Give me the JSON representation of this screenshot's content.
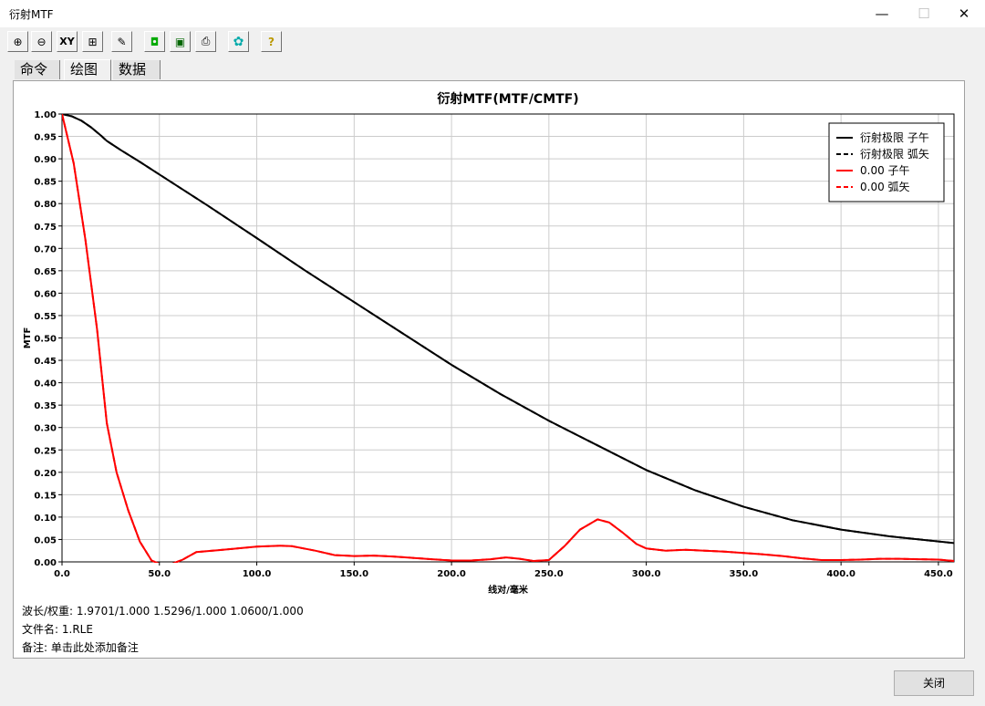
{
  "window": {
    "title": "衍射MTF",
    "minimize": "—",
    "maximize": "☐",
    "close": "✕"
  },
  "toolbar": {
    "buttons": [
      {
        "name": "zoom-in-icon",
        "glyph": "⊕"
      },
      {
        "name": "zoom-out-icon",
        "glyph": "⊖"
      },
      {
        "name": "xy-icon",
        "glyph": "XY"
      },
      {
        "name": "fit-icon",
        "glyph": "⊞"
      },
      {
        "name": "pen-icon",
        "glyph": "✎"
      },
      {
        "name": "camera-icon",
        "glyph": "◘"
      },
      {
        "name": "save-icon",
        "glyph": "▣"
      },
      {
        "name": "print-icon",
        "glyph": "⎙"
      },
      {
        "name": "settings-icon",
        "glyph": "✿"
      },
      {
        "name": "help-icon",
        "glyph": "?"
      }
    ]
  },
  "tabs": [
    "命令",
    "绘图",
    "数据"
  ],
  "active_tab": 1,
  "info": {
    "wavelength_label": "波长/权重:",
    "wavelength_value": "1.9701/1.000  1.5296/1.000  1.0600/1.000",
    "file_label": "文件名:",
    "file_value": "1.RLE",
    "note_label": "备注:",
    "note_value": "单击此处添加备注"
  },
  "close_button": "关闭",
  "colors": {
    "black_series": "#000000",
    "red_series": "#ff0000",
    "grid": "#cccccc"
  },
  "chart_data": {
    "type": "line",
    "title": "衍射MTF(MTF/CMTF)",
    "xlabel": "线对/毫米",
    "ylabel": "MTF",
    "xlim": [
      0,
      458
    ],
    "ylim": [
      0,
      1.0
    ],
    "xticks": [
      0,
      50,
      100,
      150,
      200,
      250,
      300,
      350,
      400,
      450
    ],
    "xtick_labels": [
      "0.0",
      "50.0",
      "100.0",
      "150.0",
      "200.0",
      "250.0",
      "300.0",
      "350.0",
      "400.0",
      "450.0"
    ],
    "yticks": [
      0,
      0.05,
      0.1,
      0.15,
      0.2,
      0.25,
      0.3,
      0.35,
      0.4,
      0.45,
      0.5,
      0.55,
      0.6,
      0.65,
      0.7,
      0.75,
      0.8,
      0.85,
      0.9,
      0.95,
      1.0
    ],
    "ytick_labels": [
      "0.00",
      "0.05",
      "0.10",
      "0.15",
      "0.20",
      "0.25",
      "0.30",
      "0.35",
      "0.40",
      "0.45",
      "0.50",
      "0.55",
      "0.60",
      "0.65",
      "0.70",
      "0.75",
      "0.80",
      "0.85",
      "0.90",
      "0.95",
      "1.00"
    ],
    "grid": true,
    "legend_position": "top-right",
    "series": [
      {
        "name": "衍射极限 子午",
        "color": "#000000",
        "dash": "solid",
        "x": [
          0,
          5,
          10,
          15,
          20,
          23,
          30,
          40,
          50,
          75,
          100,
          125,
          150,
          175,
          200,
          225,
          250,
          275,
          300,
          325,
          350,
          375,
          400,
          425,
          458
        ],
        "y": [
          1.0,
          0.995,
          0.985,
          0.97,
          0.952,
          0.94,
          0.92,
          0.893,
          0.865,
          0.795,
          0.723,
          0.65,
          0.58,
          0.51,
          0.44,
          0.375,
          0.315,
          0.26,
          0.205,
          0.16,
          0.123,
          0.093,
          0.072,
          0.057,
          0.042
        ]
      },
      {
        "name": "衍射极限 弧矢",
        "color": "#000000",
        "dash": "dashed",
        "x": [
          0,
          5,
          10,
          15,
          20,
          23,
          30,
          40,
          50,
          75,
          100,
          125,
          150,
          175,
          200,
          225,
          250,
          275,
          300,
          325,
          350,
          375,
          400,
          425,
          458
        ],
        "y": [
          1.0,
          0.995,
          0.985,
          0.97,
          0.952,
          0.94,
          0.92,
          0.893,
          0.865,
          0.795,
          0.723,
          0.65,
          0.58,
          0.51,
          0.44,
          0.375,
          0.315,
          0.26,
          0.205,
          0.16,
          0.123,
          0.093,
          0.072,
          0.057,
          0.042
        ]
      },
      {
        "name": "0.00 子午",
        "color": "#ff0000",
        "dash": "solid",
        "x": [
          0,
          6,
          12,
          18,
          23,
          28,
          34,
          40,
          46,
          52,
          56,
          62,
          69,
          80,
          90,
          100,
          112,
          118,
          130,
          140,
          150,
          160,
          170,
          180,
          190,
          200,
          210,
          220,
          228,
          235,
          242,
          250,
          258,
          266,
          275,
          281,
          288,
          295,
          300,
          310,
          320,
          330,
          340,
          350,
          360,
          370,
          380,
          390,
          400,
          410,
          420,
          430,
          440,
          450,
          458
        ],
        "y": [
          1.0,
          0.89,
          0.72,
          0.52,
          0.31,
          0.2,
          0.115,
          0.045,
          0.003,
          -0.008,
          -0.005,
          0.005,
          0.022,
          0.026,
          0.03,
          0.034,
          0.036,
          0.035,
          0.025,
          0.015,
          0.013,
          0.014,
          0.012,
          0.009,
          0.006,
          0.003,
          0.003,
          0.006,
          0.01,
          0.007,
          0.002,
          0.004,
          0.035,
          0.072,
          0.095,
          0.088,
          0.065,
          0.04,
          0.03,
          0.025,
          0.027,
          0.025,
          0.023,
          0.02,
          0.017,
          0.013,
          0.008,
          0.004,
          0.004,
          0.005,
          0.007,
          0.007,
          0.006,
          0.005,
          0.002
        ]
      },
      {
        "name": "0.00 弧矢",
        "color": "#ff0000",
        "dash": "dashed",
        "x": [
          0,
          6,
          12,
          18,
          23,
          28,
          34,
          40,
          46,
          52,
          56,
          62,
          69,
          80,
          90,
          100,
          112,
          118,
          130,
          140,
          150,
          160,
          170,
          180,
          190,
          200,
          210,
          220,
          228,
          235,
          242,
          250,
          258,
          266,
          275,
          281,
          288,
          295,
          300,
          310,
          320,
          330,
          340,
          350,
          360,
          370,
          380,
          390,
          400,
          410,
          420,
          430,
          440,
          450,
          458
        ],
        "y": [
          1.0,
          0.89,
          0.72,
          0.52,
          0.31,
          0.2,
          0.115,
          0.045,
          0.003,
          -0.008,
          -0.005,
          0.005,
          0.022,
          0.026,
          0.03,
          0.034,
          0.036,
          0.035,
          0.025,
          0.015,
          0.013,
          0.014,
          0.012,
          0.009,
          0.006,
          0.003,
          0.003,
          0.006,
          0.01,
          0.007,
          0.002,
          0.004,
          0.035,
          0.072,
          0.095,
          0.088,
          0.065,
          0.04,
          0.03,
          0.025,
          0.027,
          0.025,
          0.023,
          0.02,
          0.017,
          0.013,
          0.008,
          0.004,
          0.004,
          0.005,
          0.007,
          0.007,
          0.006,
          0.005,
          0.002
        ]
      }
    ]
  }
}
